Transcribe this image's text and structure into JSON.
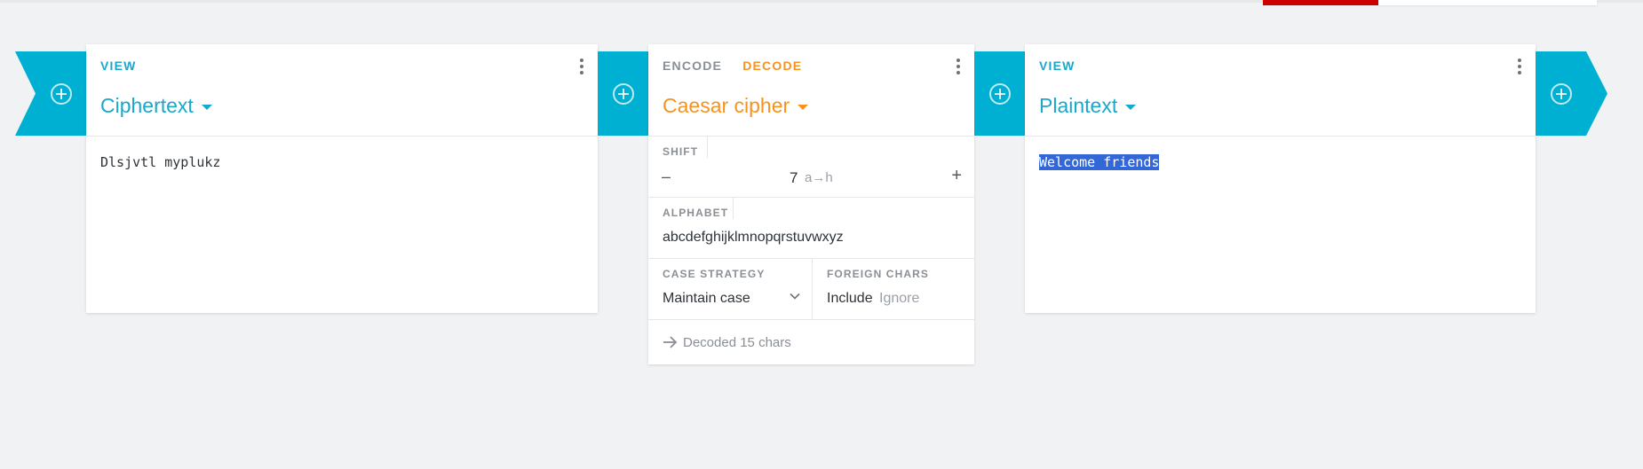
{
  "pipeline": {
    "cards": [
      {
        "tabs": [
          "VIEW"
        ],
        "title": "Ciphertext",
        "content": "Dlsjvtl myplukz"
      },
      {
        "tabs": [
          "ENCODE",
          "DECODE"
        ],
        "title": "Caesar cipher",
        "settings": {
          "shift": {
            "label": "SHIFT",
            "value": "7",
            "hint": "a→h"
          },
          "alphabet": {
            "label": "ALPHABET",
            "value": "abcdefghijklmnopqrstuvwxyz"
          },
          "case_strategy": {
            "label": "CASE STRATEGY",
            "value": "Maintain case"
          },
          "foreign_chars": {
            "label": "FOREIGN CHARS",
            "options": [
              "Include",
              "Ignore"
            ],
            "selected": "Include"
          }
        },
        "status": "Decoded 15 chars"
      },
      {
        "tabs": [
          "VIEW"
        ],
        "title": "Plaintext",
        "content": "Welcome friends"
      }
    ]
  },
  "colors": {
    "accent_blue": "#1aa7cc",
    "connector_blue": "#00b0d2",
    "accent_orange": "#f7921e",
    "selection": "#3366d6",
    "topbar_red": "#cc0000"
  },
  "icons": {
    "menu": "more-vert-icon",
    "add": "plus-circle-icon",
    "dropdown": "caret-down-icon",
    "select": "chevron-down-icon",
    "status": "arrow-right-icon"
  }
}
